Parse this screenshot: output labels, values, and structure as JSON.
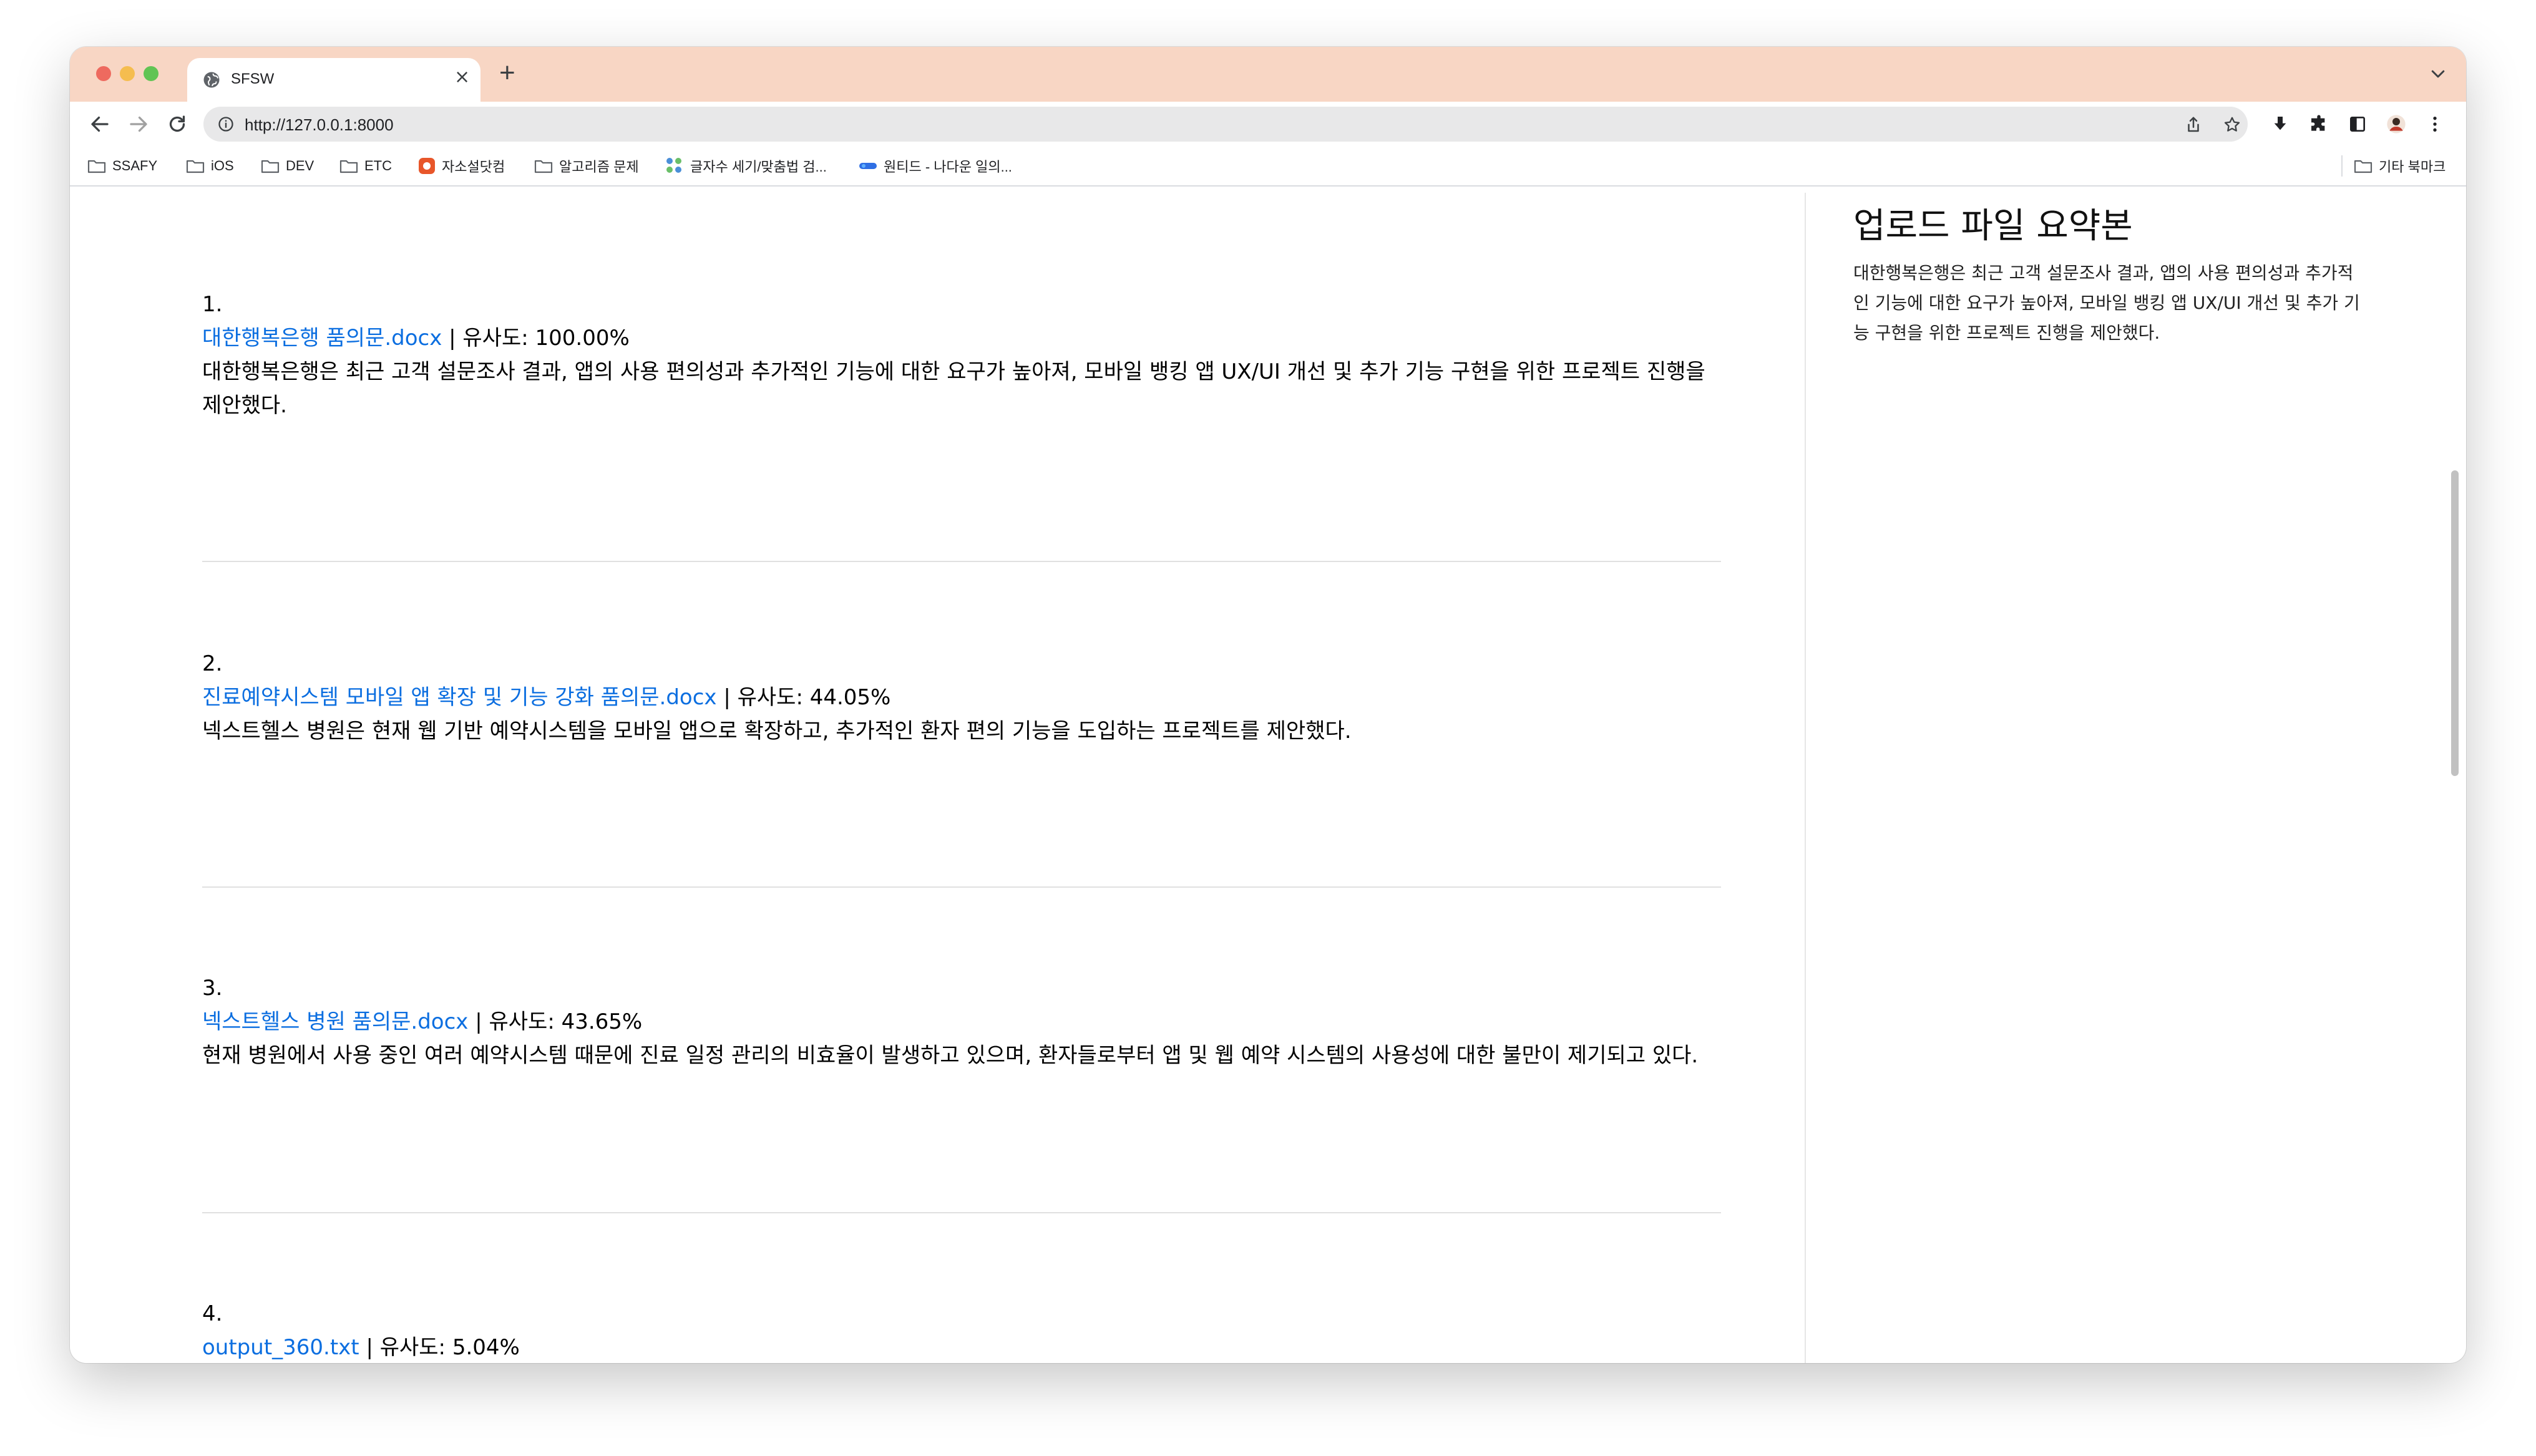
{
  "browser": {
    "tab_title": "SFSW",
    "url": "http://127.0.0.1:8000",
    "new_tab_label": "+",
    "close_label": "×"
  },
  "bookmarks": [
    {
      "label": "SSAFY",
      "icon": "folder-icon"
    },
    {
      "label": "iOS",
      "icon": "folder-icon"
    },
    {
      "label": "DEV",
      "icon": "folder-icon"
    },
    {
      "label": "ETC",
      "icon": "folder-icon"
    },
    {
      "label": "자소설닷컴",
      "icon": "site-icon"
    },
    {
      "label": "알고리즘 문제",
      "icon": "folder-icon"
    },
    {
      "label": "글자수 세기/맞춤법 검...",
      "icon": "site-icon"
    },
    {
      "label": "원티드 - 나다운 일의...",
      "icon": "site-icon"
    }
  ],
  "other_bookmarks": "기타 북마크",
  "results": [
    {
      "number": "1.",
      "filename": "대한행복은행 품의문.docx",
      "similarity": " | 유사도: 100.00%",
      "description": "대한행복은행은 최근 고객 설문조사 결과, 앱의 사용 편의성과 추가적인 기능에 대한 요구가 높아져, 모바일 뱅킹 앱 UX/UI 개선 및 추가 기능 구현을 위한 프로젝트 진행을 제안했다."
    },
    {
      "number": "2.",
      "filename": "진료예약시스템 모바일 앱 확장 및 기능 강화 품의문.docx",
      "similarity": " | 유사도: 44.05%",
      "description": "넥스트헬스 병원은 현재 웹 기반 예약시스템을 모바일 앱으로 확장하고, 추가적인 환자 편의 기능을 도입하는 프로젝트를 제안했다."
    },
    {
      "number": "3.",
      "filename": "넥스트헬스 병원 품의문.docx",
      "similarity": " | 유사도: 43.65%",
      "description": "현재 병원에서 사용 중인 여러 예약시스템 때문에 진료 일정 관리의 비효율이 발생하고 있으며, 환자들로부터 앱 및 웹 예약 시스템의 사용성에 대한 불만이 제기되고 있다."
    },
    {
      "number": "4.",
      "filename": "output_360.txt",
      "similarity": " | 유사도: 5.04%",
      "description": ""
    }
  ],
  "summary": {
    "title": "업로드 파일 요약본",
    "body": "대한행복은행은 최근 고객 설문조사 결과, 앱의 사용 편의성과 추가적인 기능에 대한 요구가 높아져, 모바일 뱅킹 앱 UX/UI 개선 및 추가 기능 구현을 위한 프로젝트 진행을 제안했다."
  },
  "colors": {
    "tabstrip": "#f8d6c4",
    "link": "#0b6ee0"
  }
}
